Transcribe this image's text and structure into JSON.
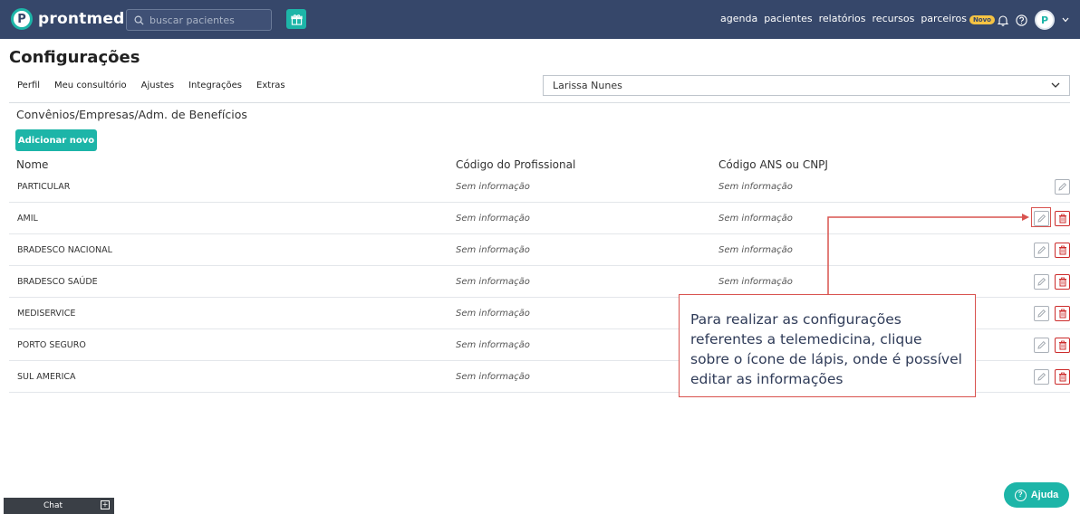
{
  "app": {
    "logo_letter": "P",
    "logo_text": "prontmed",
    "search_placeholder": "buscar pacientes",
    "nav": [
      "agenda",
      "pacientes",
      "relatórios",
      "recursos",
      "parceiros"
    ],
    "novo_badge": "Novo",
    "avatar_letter": "P",
    "colors": {
      "topbar": "#36476a",
      "accent": "#1db5a8",
      "danger": "#cc2b2b",
      "callout": "#d9534f"
    }
  },
  "page": {
    "title": "Configurações",
    "tabs": [
      "Perfil",
      "Meu consultório",
      "Ajustes",
      "Integrações",
      "Extras"
    ],
    "doctor_select": "Larissa Nunes",
    "section_title": "Convênios/Empresas/Adm. de Benefícios",
    "add_button": "Adicionar novo"
  },
  "table": {
    "headers": [
      "Nome",
      "Código do Profissional",
      "Código ANS ou CNPJ"
    ],
    "rows": [
      {
        "name": "PARTICULAR",
        "code_prof": "Sem informação",
        "code_ans": "Sem informação"
      },
      {
        "name": "AMIL",
        "code_prof": "Sem informação",
        "code_ans": "Sem informação"
      },
      {
        "name": "BRADESCO NACIONAL",
        "code_prof": "Sem informação",
        "code_ans": "Sem informação"
      },
      {
        "name": "BRADESCO SAÚDE",
        "code_prof": "Sem informação",
        "code_ans": "Sem informação"
      },
      {
        "name": "MEDISERVICE",
        "code_prof": "Sem informação",
        "code_ans": ""
      },
      {
        "name": "PORTO SEGURO",
        "code_prof": "Sem informação",
        "code_ans": ""
      },
      {
        "name": "SUL AMERICA",
        "code_prof": "Sem informação",
        "code_ans": ""
      }
    ]
  },
  "callout": {
    "text": "Para realizar as configurações referentes a telemedicina, clique sobre o ícone de lápis, onde é possível editar as informações"
  },
  "footer": {
    "chat_label": "Chat",
    "help_label": "Ajuda"
  }
}
